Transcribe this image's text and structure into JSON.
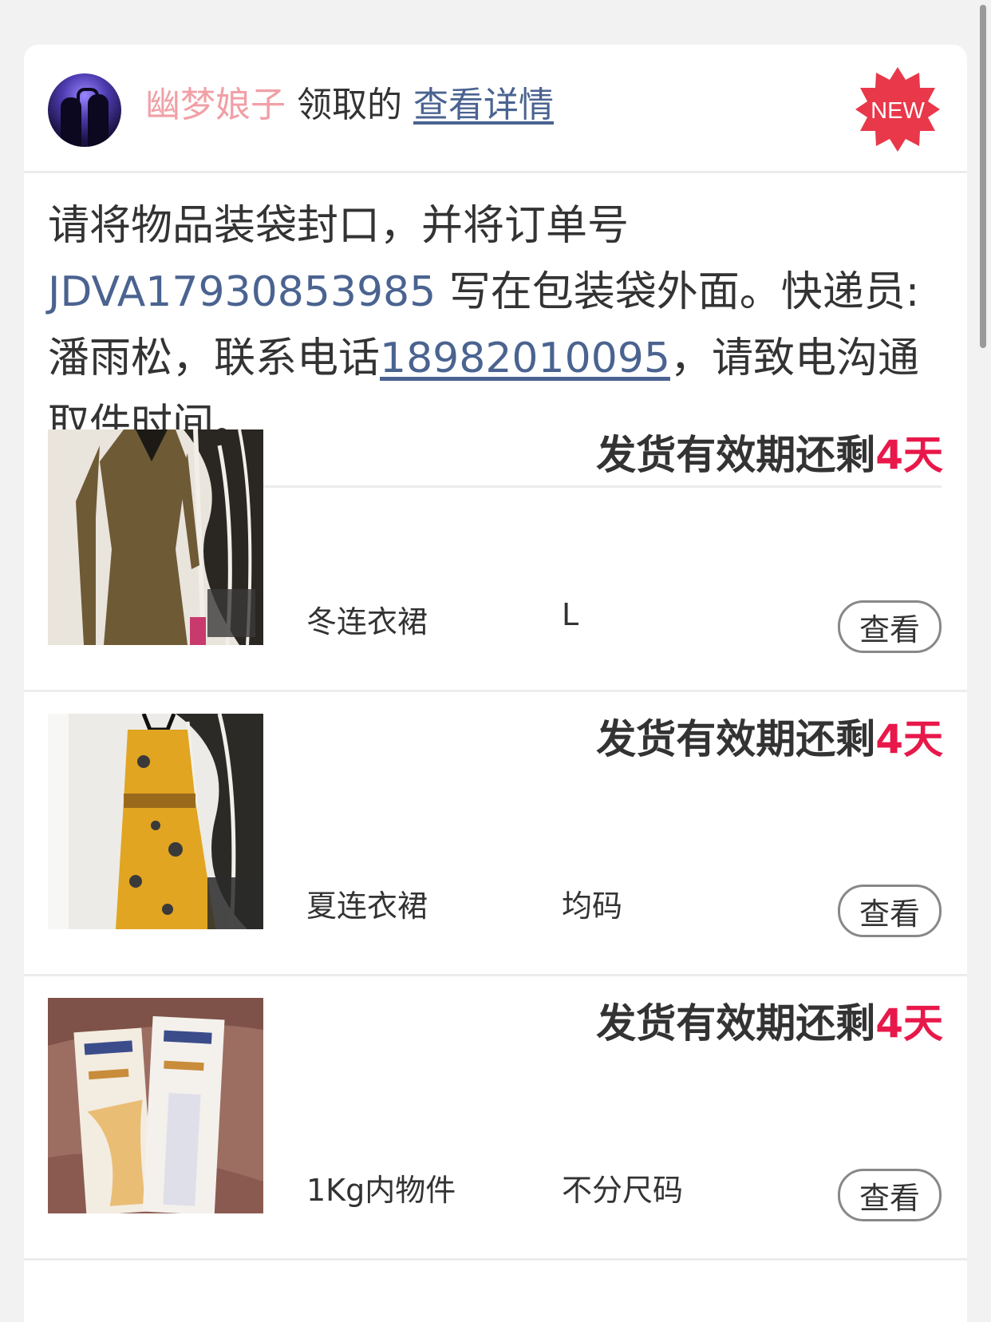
{
  "header": {
    "username": "幽梦娘子",
    "claimed_text": "领取的",
    "details_link": "查看详情",
    "badge": "NEW"
  },
  "instructions": {
    "text_before_order": "请将物品装袋封口，并将订单号 ",
    "order_number": "JDVA17930853985",
    "text_after_order": " 写在包装袋外面。快递员:潘雨松，联系电话",
    "phone": "18982010095",
    "text_end": "，请致电沟通取件时间。"
  },
  "items": [
    {
      "countdown_prefix": "发货有效期还剩",
      "countdown_days": "4天",
      "name": "冬连衣裙",
      "size": "L",
      "view_label": "查看"
    },
    {
      "countdown_prefix": "发货有效期还剩",
      "countdown_days": "4天",
      "name": "夏连衣裙",
      "size": "均码",
      "view_label": "查看"
    },
    {
      "countdown_prefix": "发货有效期还剩",
      "countdown_days": "4天",
      "name": "1Kg内物件",
      "size": "不分尺码",
      "view_label": "查看"
    }
  ],
  "colors": {
    "username": "#f0a0a6",
    "link": "#4a6390",
    "countdown_days": "#e8184a",
    "new_badge": "#e8384a"
  }
}
